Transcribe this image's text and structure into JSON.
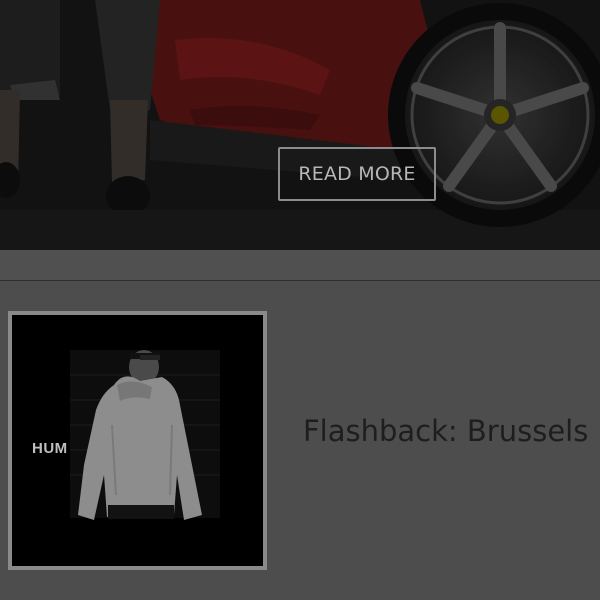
{
  "hero": {
    "button_label": "READ MORE",
    "image_subject": "car-photo"
  },
  "post": {
    "title": "Flashback: Brussels",
    "thumbnail_text": "HUM"
  },
  "colors": {
    "overlay": "#4d4d4d",
    "hero_background": "#141414",
    "car_red": "#5a1212",
    "title_text": "#1e1e1e",
    "button_border": "#8c8c8c"
  }
}
